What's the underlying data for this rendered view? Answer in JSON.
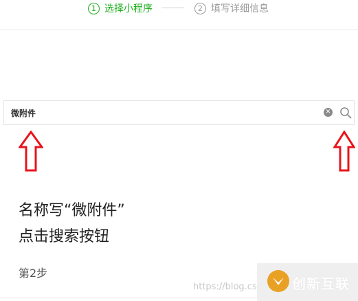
{
  "steps": [
    {
      "number": "1",
      "label": "选择小程序",
      "state": "active"
    },
    {
      "number": "2",
      "label": "填写详细信息",
      "state": "inactive"
    }
  ],
  "search": {
    "value": "微附件",
    "clear_icon": "clear-icon",
    "search_icon": "search-icon"
  },
  "annotations": {
    "arrow_color": "#e8141c",
    "line1": "名称写“微附件”",
    "line2": "点击搜索按钮",
    "step_label": "第2步"
  },
  "watermark": {
    "url": "https://blog.csdn",
    "brand": "创新互联",
    "brand_color": "#e9a125"
  },
  "colors": {
    "accent": "#1aad19",
    "inactive": "#9a9a9a"
  }
}
